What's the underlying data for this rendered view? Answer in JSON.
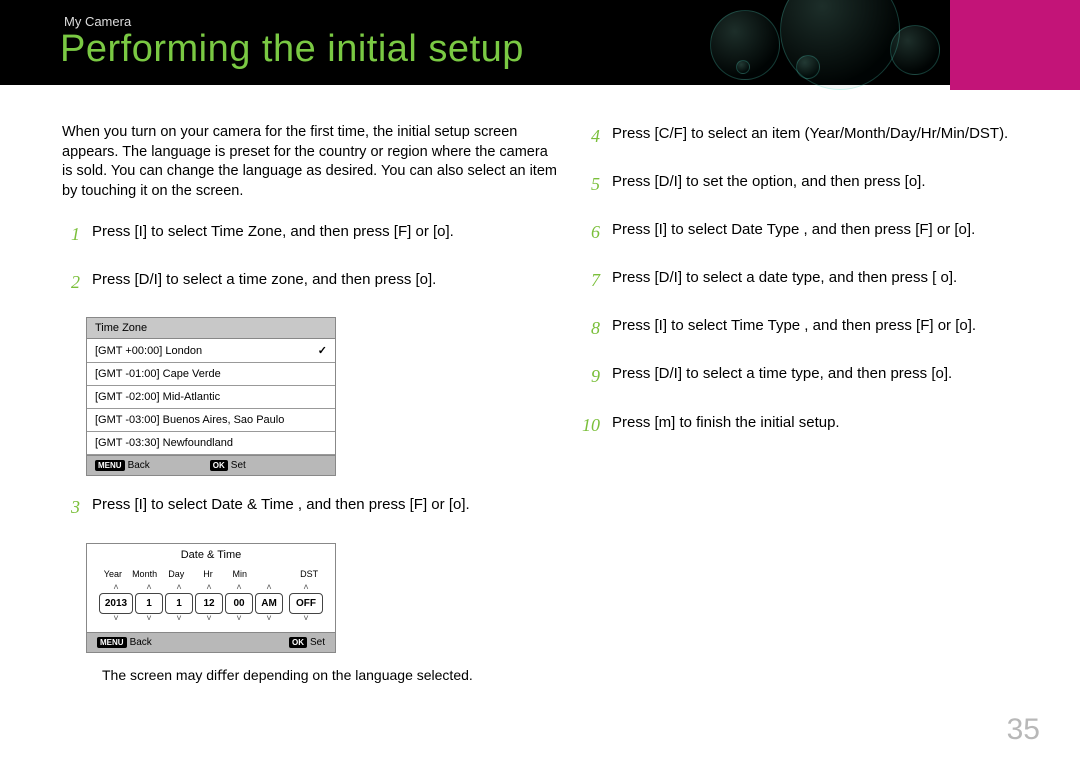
{
  "breadcrumb": "My Camera",
  "title": "Performing the initial setup",
  "intro": "When you turn on your camera for the ﬁrst time, the initial setup screen appears. The language is preset for the country or region where the camera is sold. You can change the language as desired. You can also select an item by touching it on the screen.",
  "steps_left": {
    "s1": {
      "num": "1",
      "text": "Press [I] to select Time Zone, and then press [F] or [o]."
    },
    "s2": {
      "num": "2",
      "text": "Press [D/I] to select a time zone, and then press [o]."
    },
    "s3": {
      "num": "3",
      "text": "Press [I] to select Date & Time  , and then press [F] or [o]."
    }
  },
  "steps_right": {
    "s4": {
      "num": "4",
      "text": "Press [C/F] to select an item (Year/Month/Day/Hr/Min/DST)."
    },
    "s5": {
      "num": "5",
      "text": "Press [D/I] to set the option, and then press [o]."
    },
    "s6": {
      "num": "6",
      "text": "Press [I] to select Date Type  , and then press [F] or [o]."
    },
    "s7": {
      "num": "7",
      "text": "Press [D/I] to select a date type, and then press [     o]."
    },
    "s8": {
      "num": "8",
      "text": "Press [I] to select Time Type  , and then press [F] or [o]."
    },
    "s9": {
      "num": "9",
      "text": "Press [D/I] to select a time type, and then press [o]."
    },
    "s10": {
      "num": "10",
      "text": "Press [m] to ﬁnish the initial setup."
    }
  },
  "timezone_panel": {
    "title": "Time Zone",
    "rows": [
      "[GMT +00:00] London",
      "[GMT -01:00] Cape Verde",
      "[GMT -02:00] Mid-Atlantic",
      "[GMT -03:00] Buenos Aires, Sao Paulo",
      "[GMT -03:30] Newfoundland"
    ],
    "selected_index": 0,
    "back_key": "MENU",
    "back_label": "Back",
    "set_key": "OK",
    "set_label": "Set"
  },
  "datetime_panel": {
    "title": "Date & Time",
    "labels": {
      "year": "Year",
      "month": "Month",
      "day": "Day",
      "hr": "Hr",
      "min": "Min",
      "dst": "DST"
    },
    "values": {
      "year": "2013",
      "month": "1",
      "day": "1",
      "hr": "12",
      "min": "00",
      "ampm": "AM",
      "dst": "OFF"
    },
    "back_key": "MENU",
    "back_label": "Back",
    "set_key": "OK",
    "set_label": "Set"
  },
  "note": "The screen may diﬀer depending on the language selected.",
  "page_number": "35"
}
